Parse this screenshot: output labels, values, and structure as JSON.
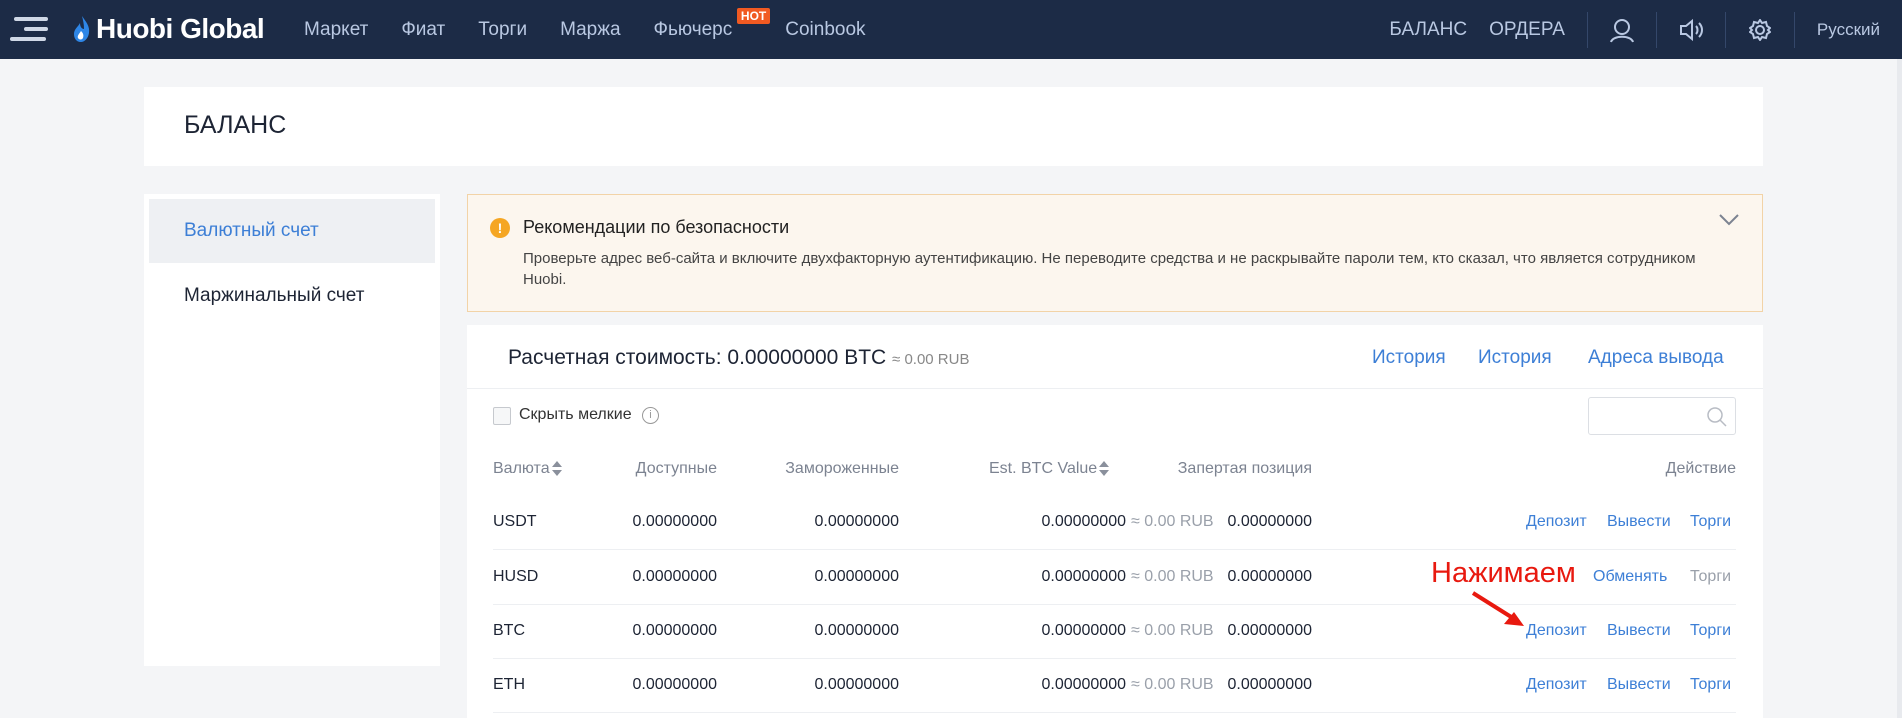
{
  "topbar": {
    "logo": "Huobi Global",
    "nav": [
      "Маркет",
      "Фиат",
      "Торги",
      "Маржа",
      "Фьючерс",
      "Coinbook"
    ],
    "hot_badge": "HOT",
    "balance_link": "БАЛАНС",
    "orders_link": "ОРДЕРА",
    "language": "Русский"
  },
  "page_title": "БАЛАНС",
  "sidebar": {
    "items": [
      {
        "label": "Валютный счет",
        "active": true
      },
      {
        "label": "Маржинальный счет",
        "active": false
      }
    ]
  },
  "alert": {
    "title": "Рекомендации по безопасности",
    "body": "Проверьте адрес веб-сайта и включите двухфакторную аутентификацию. Не переводите средства и не раскрывайте пароли тем, кто сказал, что является сотрудником Huobi.",
    "icon_glyph": "!"
  },
  "summary": {
    "label": "Расчетная стоимость: 0.00000000 BTC",
    "rub": "≈ 0.00 RUB",
    "links": [
      "История",
      "История",
      "Адреса вывода"
    ]
  },
  "filter": {
    "hide_small_label": "Скрыть мелкие",
    "info_glyph": "i",
    "search_placeholder": ""
  },
  "table": {
    "headers": {
      "currency": "Валюта",
      "available": "Доступные",
      "frozen": "Замороженные",
      "btc_value": "Est. BTC Value",
      "locked": "Запертая позиция",
      "action": "Действие"
    },
    "rows": [
      {
        "currency": "USDT",
        "available": "0.00000000",
        "frozen": "0.00000000",
        "btc": "0.00000000",
        "rub": "≈ 0.00 RUB",
        "locked": "0.00000000",
        "actions": [
          "Депозит",
          "Вывести",
          "Торги"
        ]
      },
      {
        "currency": "HUSD",
        "available": "0.00000000",
        "frozen": "0.00000000",
        "btc": "0.00000000",
        "rub": "≈ 0.00 RUB",
        "locked": "0.00000000",
        "actions": [
          "",
          "Обменять",
          "Торги"
        ]
      },
      {
        "currency": "BTC",
        "available": "0.00000000",
        "frozen": "0.00000000",
        "btc": "0.00000000",
        "rub": "≈ 0.00 RUB",
        "locked": "0.00000000",
        "actions": [
          "Депозит",
          "Вывести",
          "Торги"
        ]
      },
      {
        "currency": "ETH",
        "available": "0.00000000",
        "frozen": "0.00000000",
        "btc": "0.00000000",
        "rub": "≈ 0.00 RUB",
        "locked": "0.00000000",
        "actions": [
          "Депозит",
          "Вывести",
          "Торги"
        ]
      }
    ]
  },
  "annotation": "Нажимаем",
  "colors": {
    "nav_bg": "#1c2b46",
    "accent": "#3d7fd6",
    "annotation": "#e8190f",
    "warn": "#f5a623"
  }
}
